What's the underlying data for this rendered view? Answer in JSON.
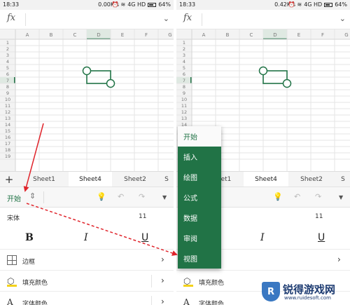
{
  "left": {
    "status": {
      "time": "18:33",
      "speed": "0.00K/s",
      "network": "4G HD",
      "battery": "64%"
    },
    "sheet_tabs": [
      "Sheet1",
      "Sheet4",
      "Sheet2"
    ],
    "ribbon_tab": "开始",
    "font_name": "宋体",
    "font_size": "11",
    "rows": [
      {
        "label": "边框",
        "icon": "border-icon"
      },
      {
        "label": "填充颜色",
        "icon": "fill-color-icon"
      },
      {
        "label": "字体颜色",
        "icon": "font-color-icon"
      }
    ]
  },
  "right": {
    "status": {
      "time": "18:33",
      "speed": "0.42K/s",
      "network": "4G HD",
      "battery": "64%"
    },
    "sheet_tabs": [
      "et1",
      "Sheet4",
      "Sheet2"
    ],
    "font_size": "11",
    "menu": [
      "开始",
      "插入",
      "绘图",
      "公式",
      "数据",
      "审阅",
      "视图"
    ],
    "rows": [
      {
        "label": "填充颜色",
        "icon": "fill-color-icon"
      },
      {
        "label": "字体颜色",
        "icon": "font-color-icon"
      }
    ]
  },
  "grid": {
    "columns": [
      "A",
      "B",
      "C",
      "D",
      "E",
      "F",
      "G"
    ],
    "rows": [
      "1",
      "2",
      "3",
      "4",
      "5",
      "6",
      "7",
      "8",
      "9",
      "10",
      "11",
      "12",
      "13",
      "14",
      "15",
      "16",
      "17",
      "18",
      "19"
    ],
    "selected_col": "D"
  },
  "watermark": {
    "title": "锐得游戏网",
    "url": "www.ruidesoft.com"
  },
  "colors": {
    "accent": "#217346",
    "arrow": "#e0242b",
    "fill_yellow": "#f4d21b"
  }
}
